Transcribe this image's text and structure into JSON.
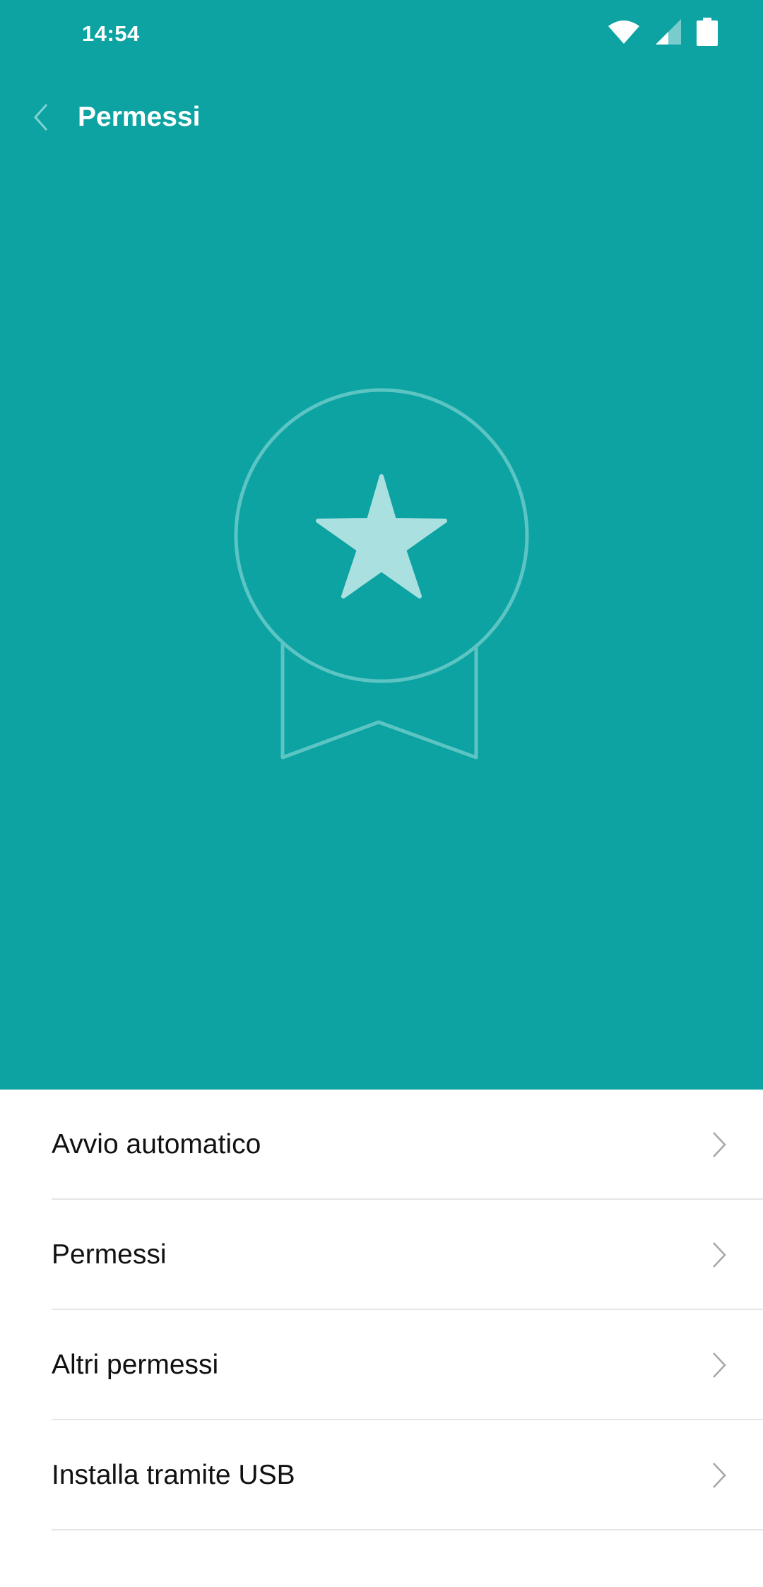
{
  "status_bar": {
    "time": "14:54",
    "icons": [
      "wifi-icon",
      "cell-signal-icon",
      "battery-icon"
    ]
  },
  "header": {
    "back_icon": "chevron-left-icon",
    "title": "Permessi"
  },
  "hero": {
    "background_color": "#0ca3a2",
    "illustration": "award-badge-star-icon"
  },
  "menu": {
    "items": [
      {
        "label": "Avvio automatico"
      },
      {
        "label": "Permessi"
      },
      {
        "label": "Altri permessi"
      },
      {
        "label": "Installa tramite USB"
      }
    ],
    "item_icon": "chevron-right-icon"
  }
}
